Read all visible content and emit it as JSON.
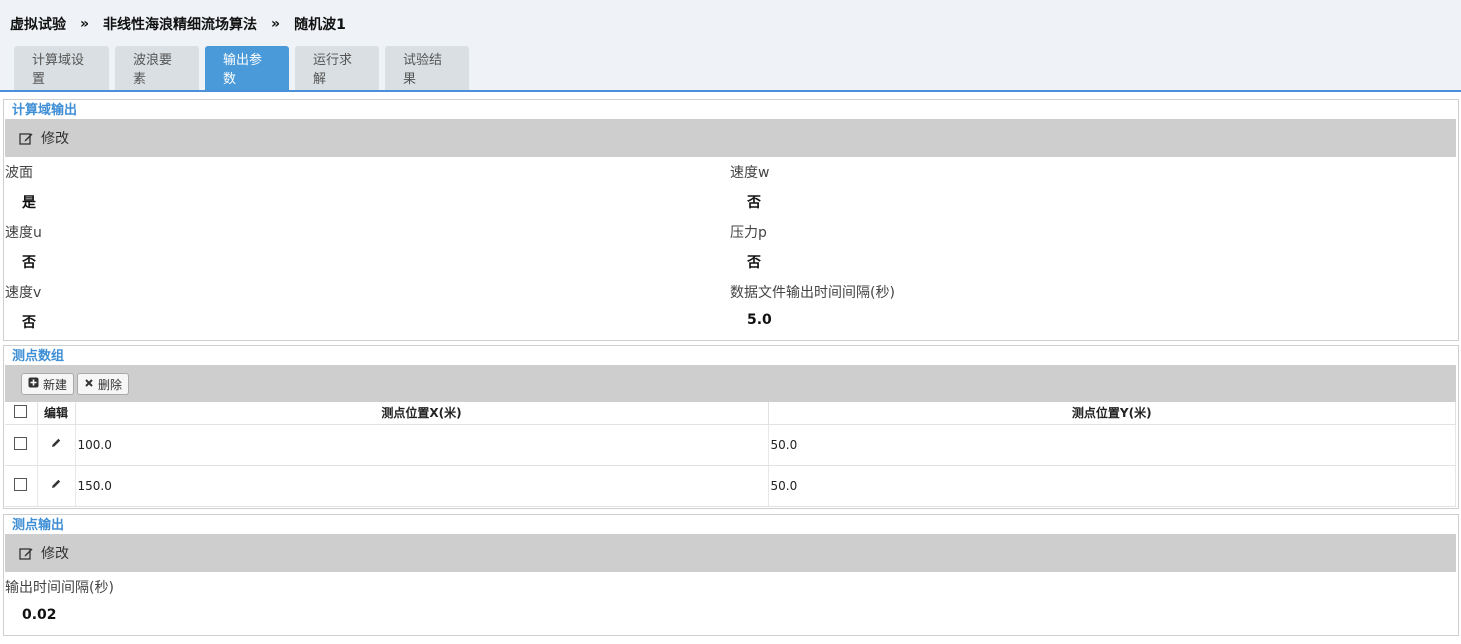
{
  "breadcrumb": [
    "虚拟试验",
    "非线性海浪精细流场算法",
    "随机波1"
  ],
  "breadcrumb_separator": "»",
  "tabs": [
    {
      "label": "计算域设置",
      "active": false
    },
    {
      "label": "波浪要素",
      "active": false
    },
    {
      "label": "输出参数",
      "active": true
    },
    {
      "label": "运行求解",
      "active": false
    },
    {
      "label": "试验结果",
      "active": false
    }
  ],
  "domain_output": {
    "title": "计算域输出",
    "edit_label": "修改",
    "fields": {
      "wave_surface": {
        "label": "波面",
        "value": "是"
      },
      "velocity_u": {
        "label": "速度u",
        "value": "否"
      },
      "velocity_v": {
        "label": "速度v",
        "value": "否"
      },
      "velocity_w": {
        "label": "速度w",
        "value": "否"
      },
      "pressure_p": {
        "label": "压力p",
        "value": "否"
      },
      "file_interval": {
        "label": "数据文件输出时间间隔(秒)",
        "value": "5.0"
      }
    }
  },
  "probe_array": {
    "title": "测点数组",
    "new_label": "新建",
    "delete_label": "删除",
    "columns": {
      "edit": "编辑",
      "x": "测点位置X(米)",
      "y": "测点位置Y(米)"
    },
    "rows": [
      {
        "x": "100.0",
        "y": "50.0"
      },
      {
        "x": "150.0",
        "y": "50.0"
      }
    ]
  },
  "probe_output": {
    "title": "测点输出",
    "edit_label": "修改",
    "interval_label": "输出时间间隔(秒)",
    "interval_value": "0.02"
  },
  "colors": {
    "accent": "#4a9ad9",
    "toolbar": "#cecece"
  }
}
